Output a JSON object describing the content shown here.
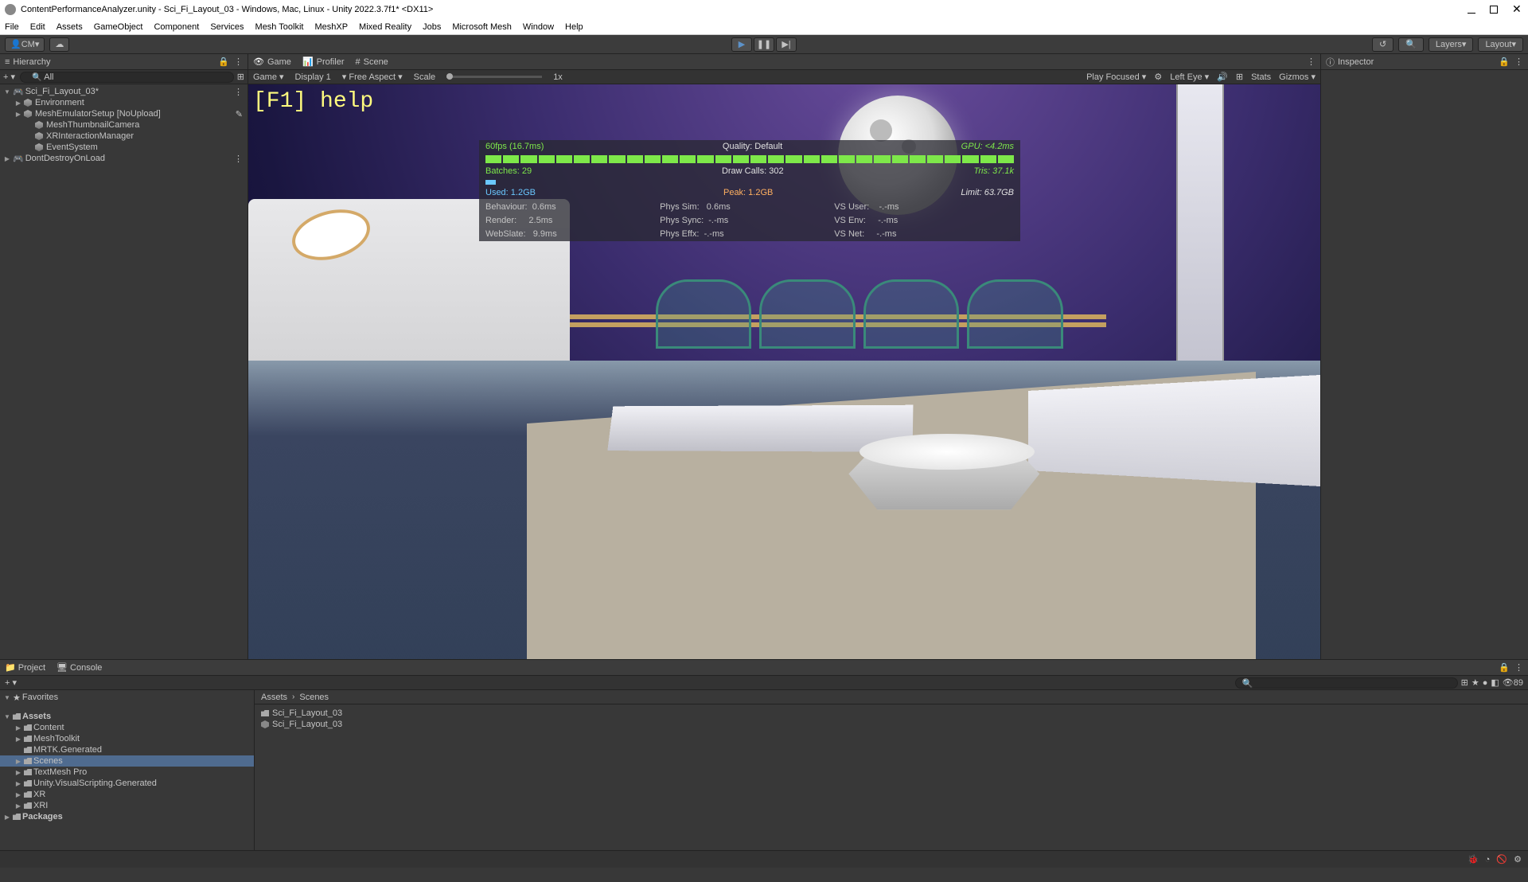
{
  "window": {
    "title": "ContentPerformanceAnalyzer.unity - Sci_Fi_Layout_03 - Windows, Mac, Linux - Unity 2022.3.7f1* <DX11>"
  },
  "menu": [
    "File",
    "Edit",
    "Assets",
    "GameObject",
    "Component",
    "Services",
    "Mesh Toolkit",
    "MeshXP",
    "Mixed Reality",
    "Jobs",
    "Microsoft Mesh",
    "Window",
    "Help"
  ],
  "toolbar": {
    "account": "CM",
    "layers": "Layers",
    "layout": "Layout"
  },
  "hierarchy": {
    "title": "Hierarchy",
    "search_placeholder": "All",
    "items": [
      {
        "label": "Sci_Fi_Layout_03*",
        "indent": 0,
        "arrow": "▼"
      },
      {
        "label": "Environment",
        "indent": 1,
        "arrow": "▶"
      },
      {
        "label": "MeshEmulatorSetup [NoUpload]",
        "indent": 1,
        "arrow": "▶",
        "pen": true
      },
      {
        "label": "MeshThumbnailCamera",
        "indent": 1,
        "arrow": ""
      },
      {
        "label": "XRInteractionManager",
        "indent": 1,
        "arrow": ""
      },
      {
        "label": "EventSystem",
        "indent": 1,
        "arrow": ""
      },
      {
        "label": "DontDestroyOnLoad",
        "indent": 0,
        "arrow": "▶"
      }
    ]
  },
  "game_tabs": {
    "game": "Game",
    "profiler": "Profiler",
    "scene": "Scene"
  },
  "game_toolbar": {
    "mode": "Game",
    "display": "Display 1",
    "aspect": "Free Aspect",
    "scale": "Scale",
    "scale_val": "1x",
    "play_focused": "Play Focused",
    "eye": "Left Eye",
    "stats": "Stats",
    "gizmos": "Gizmos"
  },
  "overlay": {
    "help": "[F1] help",
    "row1_a": "60fps (16.7ms)",
    "row1_b": "Quality: Default",
    "row1_c": "GPU: <4.2ms",
    "row2_a": "Batches: 29",
    "row2_b": "Draw Calls: 302",
    "row2_c": "Tris: 37.1k",
    "row3_a": "Used: 1.2GB",
    "row3_b": "Peak: 1.2GB",
    "row3_c": "Limit: 63.7GB",
    "row4": [
      {
        "l": "Behaviour:",
        "v": "0.6ms",
        "c": "g"
      },
      {
        "l": "Phys Sim:",
        "v": "0.6ms",
        "c": "o"
      },
      {
        "l": "VS User:",
        "v": "-.-ms",
        "c": "w"
      }
    ],
    "row5": [
      {
        "l": "Render:",
        "v": "2.5ms",
        "c": "g"
      },
      {
        "l": "Phys Sync:",
        "v": "-.-ms",
        "c": "w"
      },
      {
        "l": "VS Env:",
        "v": "-.-ms",
        "c": "w"
      }
    ],
    "row6": [
      {
        "l": "WebSlate:",
        "v": "9.9ms",
        "c": "g"
      },
      {
        "l": "Phys Effx:",
        "v": "-.-ms",
        "c": "w"
      },
      {
        "l": "VS Net:",
        "v": "-.-ms",
        "c": "w"
      }
    ]
  },
  "inspector": {
    "title": "Inspector"
  },
  "bottom": {
    "project": "Project",
    "console": "Console",
    "favorites": "Favorites",
    "tree": [
      {
        "label": "Assets",
        "arrow": "▼",
        "indent": 0
      },
      {
        "label": "Content",
        "arrow": "▶",
        "indent": 1
      },
      {
        "label": "MeshToolkit",
        "arrow": "▶",
        "indent": 1
      },
      {
        "label": "MRTK.Generated",
        "arrow": "",
        "indent": 1
      },
      {
        "label": "Scenes",
        "arrow": "▶",
        "indent": 1,
        "selected": true
      },
      {
        "label": "TextMesh Pro",
        "arrow": "▶",
        "indent": 1
      },
      {
        "label": "Unity.VisualScripting.Generated",
        "arrow": "▶",
        "indent": 1
      },
      {
        "label": "XR",
        "arrow": "▶",
        "indent": 1
      },
      {
        "label": "XRI",
        "arrow": "▶",
        "indent": 1
      },
      {
        "label": "Packages",
        "arrow": "▶",
        "indent": 0
      }
    ],
    "breadcrumb": [
      "Assets",
      "Scenes"
    ],
    "content": [
      {
        "label": "Sci_Fi_Layout_03",
        "type": "folder"
      },
      {
        "label": "Sci_Fi_Layout_03",
        "type": "scene"
      }
    ]
  }
}
